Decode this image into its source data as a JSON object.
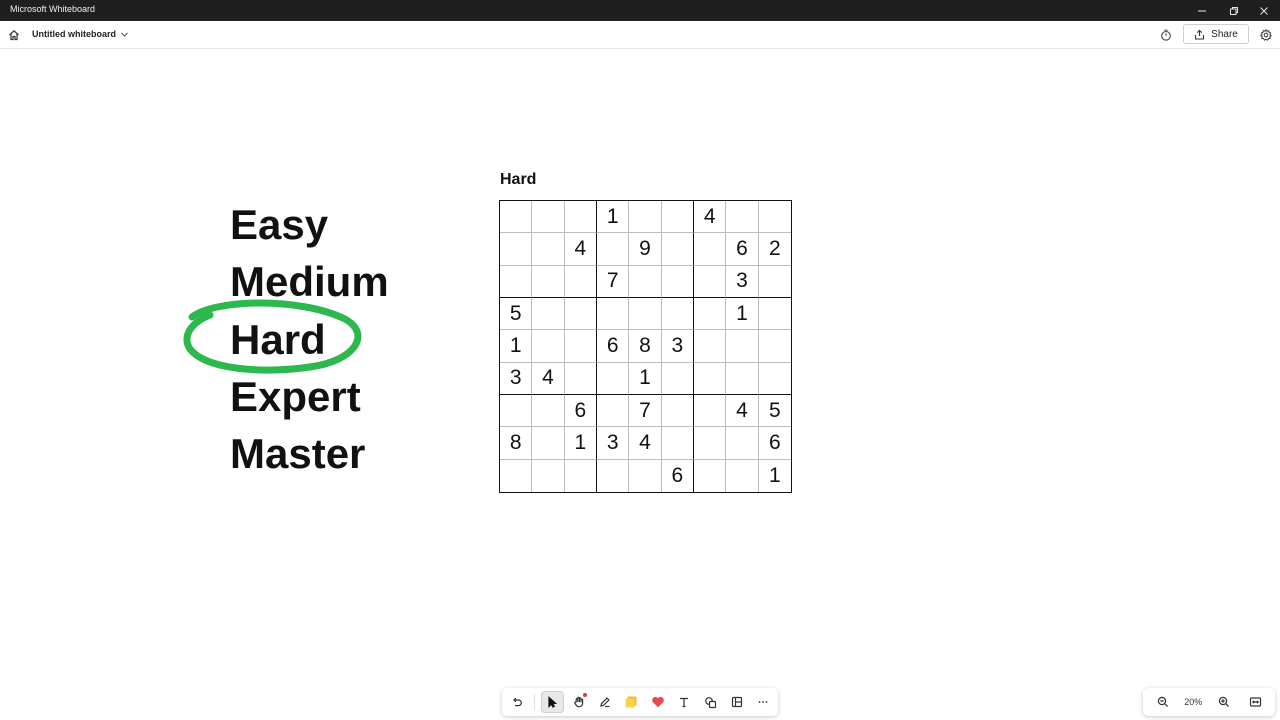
{
  "window": {
    "title": "Microsoft Whiteboard"
  },
  "header": {
    "board_name": "Untitled whiteboard",
    "share_label": "Share"
  },
  "canvas": {
    "levels": [
      "Easy",
      "Medium",
      "Hard",
      "Expert",
      "Master"
    ],
    "circled_level": "Hard",
    "ink_color": "#2db84d",
    "sudoku": {
      "title": "Hard",
      "rows": [
        [
          "",
          "",
          "",
          "1",
          "",
          "",
          "4",
          "",
          ""
        ],
        [
          "",
          "",
          "4",
          "",
          "9",
          "",
          "",
          "6",
          "2"
        ],
        [
          "",
          "",
          "",
          "7",
          "",
          "",
          "",
          "3",
          ""
        ],
        [
          "5",
          "",
          "",
          "",
          "",
          "",
          "",
          "1",
          ""
        ],
        [
          "1",
          "",
          "",
          "6",
          "8",
          "3",
          "",
          "",
          ""
        ],
        [
          "3",
          "4",
          "",
          "",
          "1",
          "",
          "",
          "",
          ""
        ],
        [
          "",
          "",
          "6",
          "",
          "7",
          "",
          "",
          "4",
          "5"
        ],
        [
          "8",
          "",
          "1",
          "3",
          "4",
          "",
          "",
          "",
          "6"
        ],
        [
          "",
          "",
          "",
          "",
          "",
          "6",
          "",
          "",
          "1"
        ]
      ]
    }
  },
  "toolbar": {
    "tools": [
      "undo-icon",
      "select-icon",
      "hand-icon",
      "pen-icon",
      "sticky-note-icon",
      "reaction-icon",
      "text-icon",
      "shapes-icon",
      "templates-icon",
      "more-icon"
    ],
    "active_tool": "select-icon"
  },
  "zoom": {
    "level": "20%"
  }
}
